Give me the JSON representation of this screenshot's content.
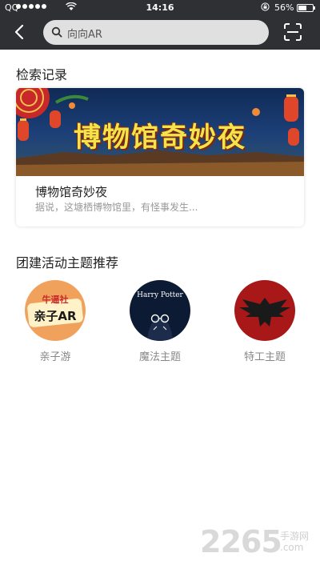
{
  "status_bar": {
    "carrier": "QQ",
    "time": "14:16",
    "battery": "56%"
  },
  "header": {
    "search_value": "向向AR",
    "back_icon": "back-arrow-icon",
    "scan_icon": "scan-icon"
  },
  "history": {
    "section_title": "检索记录",
    "card": {
      "banner_title": "博物馆奇妙夜",
      "title": "博物馆奇妙夜",
      "description": "据说，这塘栖博物馆里，有怪事发生..."
    }
  },
  "recommend": {
    "section_title": "团建活动主题推荐",
    "items": [
      {
        "label": "亲子游",
        "badge_line1": "牛逼社",
        "badge_line2": "亲子AR"
      },
      {
        "label": "魔法主题",
        "badge_line1": "Harry Potter"
      },
      {
        "label": "特工主题"
      }
    ]
  },
  "watermark": {
    "number": "2265",
    "text": "手游网",
    "domain": ".com"
  },
  "colors": {
    "topbar": "#2f3034",
    "search_bg": "#e0e0e0",
    "accent_orange": "#f0a25c"
  }
}
